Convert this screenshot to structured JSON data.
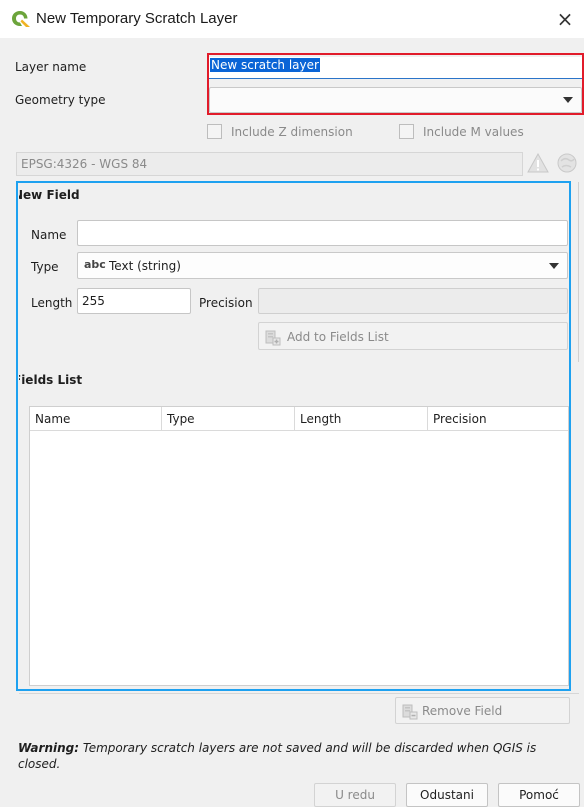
{
  "window": {
    "title": "New Temporary Scratch Layer",
    "close_glyph": "×",
    "app_icon": "qgis-logo-icon"
  },
  "layer_name": {
    "label": "Layer name",
    "value": "New scratch layer"
  },
  "geometry_type": {
    "label": "Geometry type",
    "value": ""
  },
  "dimensions": {
    "include_z": {
      "label": "Include Z dimension",
      "checked": false
    },
    "include_m": {
      "label": "Include M values",
      "checked": false
    }
  },
  "crs": {
    "value": "EPSG:4326 - WGS 84"
  },
  "new_field": {
    "heading": "New Field",
    "name_label": "Name",
    "name_value": "",
    "type_label": "Type",
    "type_badge": "abc",
    "type_value": "Text (string)",
    "length_label": "Length",
    "length_value": "255",
    "precision_label": "Precision",
    "precision_value": "",
    "add_button": "Add to Fields List"
  },
  "fields_list": {
    "heading": "Fields List",
    "columns": [
      "Name",
      "Type",
      "Length",
      "Precision"
    ],
    "rows": [],
    "remove_button": "Remove Field"
  },
  "warning": {
    "bold": "Warning:",
    "text": " Temporary scratch layers are not saved and will be discarded when QGIS is closed."
  },
  "footer": {
    "ok": "U redu",
    "cancel": "Odustani",
    "help": "Pomoć"
  },
  "colors": {
    "highlight_red": "#e11b2a",
    "highlight_blue": "#1ea1f0",
    "selection_blue": "#0a64d6"
  }
}
